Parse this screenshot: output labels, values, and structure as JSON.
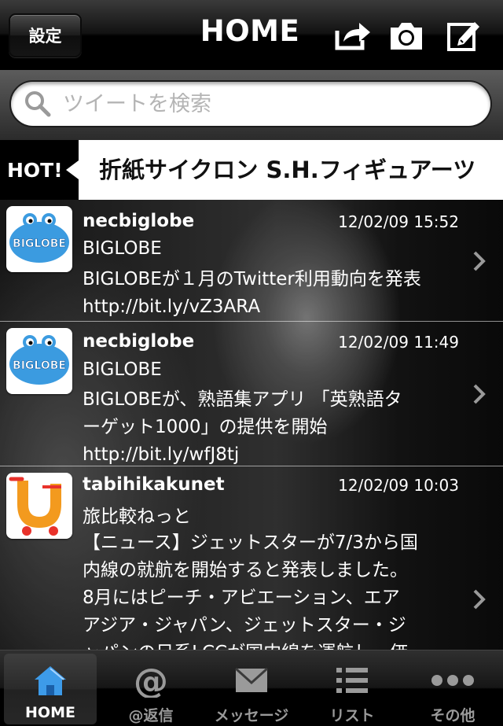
{
  "nav": {
    "settings_label": "設定",
    "title": "HOME",
    "icons": [
      "share-icon",
      "camera-icon",
      "compose-icon"
    ]
  },
  "search": {
    "placeholder": "ツイートを検索",
    "value": ""
  },
  "hot": {
    "label": "HOT!",
    "text": "折紙サイクロン S.H.フィギュアーツ"
  },
  "tweets": [
    {
      "user": "necbiglobe",
      "time": "12/02/09 15:52",
      "name": "BIGLOBE",
      "lines": [
        "BIGLOBEが１月のTwitter利用動向を発表",
        "http://bit.ly/vZ3ARA"
      ],
      "avatar": "biglobe-avatar"
    },
    {
      "user": "necbiglobe",
      "time": "12/02/09 11:49",
      "name": "BIGLOBE",
      "lines": [
        "BIGLOBEが、熟語集アプリ 「英熟語タ",
        "ーゲット1000」の提供を開始",
        "http://bit.ly/wfJ8tj"
      ],
      "avatar": "biglobe-avatar"
    },
    {
      "user": "tabihikakunet",
      "time": "12/02/09 10:03",
      "name": "旅比較ねっと",
      "lines": [
        "【ニュース】ジェットスターが7/3から国",
        "内線の就航を開始すると発表しました。",
        "8月にはピーチ・アビエーション、エア",
        "アジア・ジャパン、ジェットスター・ジ",
        "ャパンの日系LCCが国内線を運航し、価"
      ],
      "avatar": "tabihikaku-avatar"
    }
  ],
  "avatar_text": "BIGLOBE",
  "tabs": [
    {
      "label": "HOME",
      "icon": "home-icon",
      "active": true
    },
    {
      "label": "@返信",
      "icon": "at-icon",
      "active": false
    },
    {
      "label": "メッセージ",
      "icon": "envelope-icon",
      "active": false
    },
    {
      "label": "リスト",
      "icon": "list-icon",
      "active": false
    },
    {
      "label": "その他",
      "icon": "more-icon",
      "active": false
    }
  ],
  "colors": {
    "accent_blue": "#3d9be9",
    "tab_inactive": "#9a9a9a",
    "biglobe_blue": "#3b9be0",
    "tabihikaku_orange": "#f39a1e"
  }
}
